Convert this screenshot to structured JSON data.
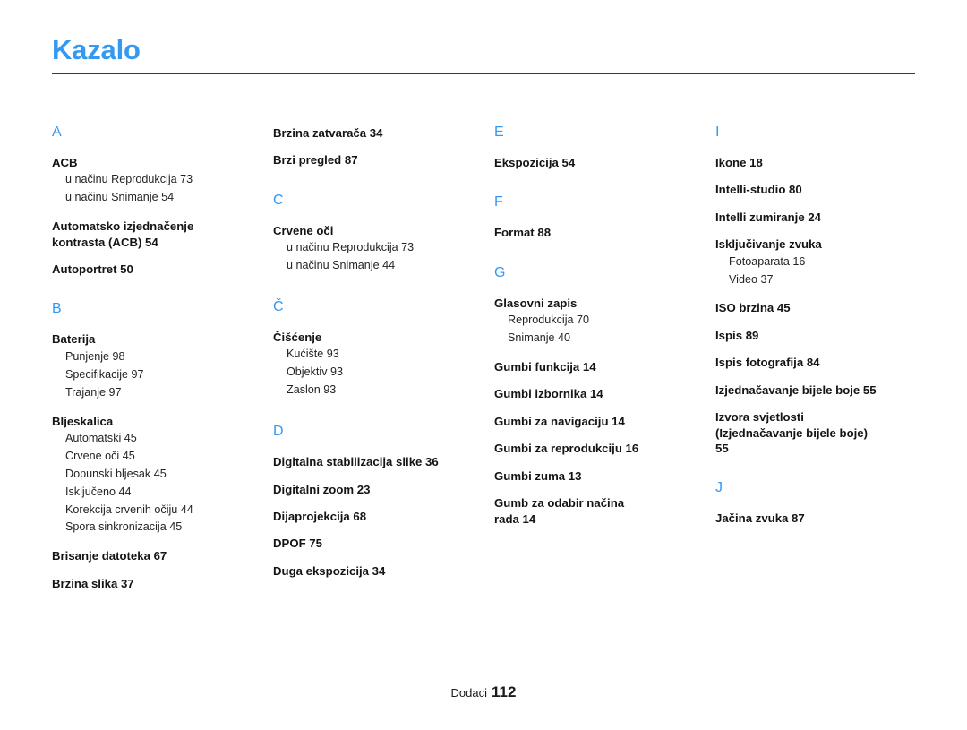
{
  "document": {
    "title": "Kazalo",
    "title_color": "#3399f3",
    "letter_heading_color": "#3399f3",
    "rule_color": "#3a3a3a"
  },
  "footer": {
    "label": "Dodaci",
    "page_number": "112"
  },
  "columns": [
    {
      "groups": [
        {
          "letter": "A",
          "entries": [
            {
              "title": "ACB",
              "subs": [
                "u načinu Reprodukcija  73",
                "u načinu Snimanje  54"
              ]
            },
            {
              "title": "Automatsko izjednačenje\nkontrasta (ACB)  54",
              "subs": []
            },
            {
              "title": "Autoportret  50",
              "subs": []
            }
          ]
        },
        {
          "letter": "B",
          "entries": [
            {
              "title": "Baterija",
              "subs": [
                "Punjenje  98",
                "Specifikacije  97",
                "Trajanje  97"
              ]
            },
            {
              "title": "Bljeskalica",
              "subs": [
                "Automatski  45",
                "Crvene oči  45",
                "Dopunski bljesak  45",
                "Isključeno  44",
                "Korekcija crvenih očiju  44",
                "Spora sinkronizacija  45"
              ]
            },
            {
              "title": "Brisanje datoteka  67",
              "subs": []
            },
            {
              "title": "Brzina slika  37",
              "subs": []
            }
          ]
        }
      ]
    },
    {
      "groups": [
        {
          "letter": "",
          "entries": [
            {
              "title": "Brzina zatvarača  34",
              "subs": []
            },
            {
              "title": "Brzi pregled  87",
              "subs": []
            }
          ]
        },
        {
          "letter": "C",
          "entries": [
            {
              "title": "Crvene oči",
              "subs": [
                "u načinu Reprodukcija  73",
                "u načinu Snimanje  44"
              ]
            }
          ]
        },
        {
          "letter": "Č",
          "entries": [
            {
              "title": "Čišćenje",
              "subs": [
                "Kućište  93",
                "Objektiv  93",
                "Zaslon  93"
              ]
            }
          ]
        },
        {
          "letter": "D",
          "entries": [
            {
              "title": "Digitalna stabilizacija slike  36",
              "subs": []
            },
            {
              "title": "Digitalni zoom  23",
              "subs": []
            },
            {
              "title": "Dijaprojekcija  68",
              "subs": []
            },
            {
              "title": "DPOF  75",
              "subs": []
            },
            {
              "title": "Duga ekspozicija  34",
              "subs": []
            }
          ]
        }
      ]
    },
    {
      "groups": [
        {
          "letter": "E",
          "entries": [
            {
              "title": "Ekspozicija  54",
              "subs": []
            }
          ]
        },
        {
          "letter": "F",
          "entries": [
            {
              "title": "Format  88",
              "subs": []
            }
          ]
        },
        {
          "letter": "G",
          "entries": [
            {
              "title": "Glasovni zapis",
              "subs": [
                "Reprodukcija  70",
                "Snimanje  40"
              ]
            },
            {
              "title": "Gumbi funkcija  14",
              "subs": []
            },
            {
              "title": "Gumbi izbornika  14",
              "subs": []
            },
            {
              "title": "Gumbi za navigaciju  14",
              "subs": []
            },
            {
              "title": "Gumbi za reprodukciju  16",
              "subs": []
            },
            {
              "title": "Gumbi zuma  13",
              "subs": []
            },
            {
              "title": "Gumb za odabir načina\nrada  14",
              "subs": []
            }
          ]
        }
      ]
    },
    {
      "groups": [
        {
          "letter": "I",
          "entries": [
            {
              "title": "Ikone  18",
              "subs": []
            },
            {
              "title": "Intelli-studio  80",
              "subs": []
            },
            {
              "title": "Intelli zumiranje  24",
              "subs": []
            },
            {
              "title": "Isključivanje zvuka",
              "subs": [
                "Fotoaparata  16",
                "Video  37"
              ]
            },
            {
              "title": "ISO brzina  45",
              "subs": []
            },
            {
              "title": "Ispis  89",
              "subs": []
            },
            {
              "title": "Ispis fotografija  84",
              "subs": []
            },
            {
              "title": "Izjednačavanje bijele boje  55",
              "subs": []
            },
            {
              "title": "Izvora svjetlosti\n(Izjednačavanje bijele boje)\n55",
              "subs": []
            }
          ]
        },
        {
          "letter": "J",
          "entries": [
            {
              "title": "Jačina zvuka  87",
              "subs": []
            }
          ]
        }
      ]
    }
  ]
}
